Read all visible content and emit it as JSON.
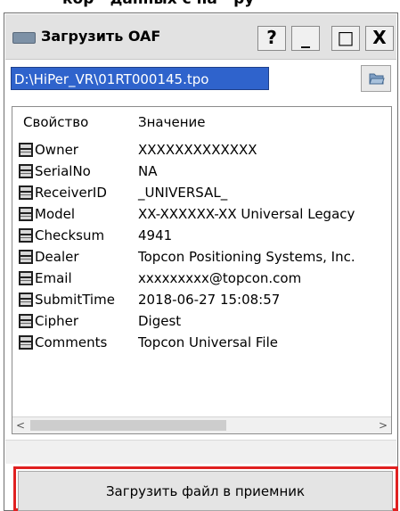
{
  "top_fragment": "кор · данных с на · ру",
  "window": {
    "title": "Загрузить OAF",
    "buttons": {
      "help": "?",
      "minimize": "_",
      "maximize": "□",
      "close": "X"
    }
  },
  "path": {
    "value": "D:\\HiPer_VR\\01RT000145.tpo"
  },
  "columns": {
    "property": "Свойство",
    "value": "Значение"
  },
  "rows": [
    {
      "name": "Owner",
      "value": "XXXXXXXXXXXXX"
    },
    {
      "name": "SerialNo",
      "value": "NA"
    },
    {
      "name": "ReceiverID",
      "value": "_UNIVERSAL_"
    },
    {
      "name": "Model",
      "value": "XX-XXXXXX-XX Universal Legacy"
    },
    {
      "name": "Checksum",
      "value": "4941"
    },
    {
      "name": "Dealer",
      "value": "Topcon Positioning Systems, Inc."
    },
    {
      "name": "Email",
      "value": "xxxxxxxxx@topcon.com"
    },
    {
      "name": "SubmitTime",
      "value": "2018-06-27 15:08:57"
    },
    {
      "name": "Cipher",
      "value": "Digest"
    },
    {
      "name": "Comments",
      "value": "Topcon Universal File"
    }
  ],
  "scroll": {
    "left": "<",
    "right": ">"
  },
  "upload_button": "Загрузить файл в приемник",
  "icons": {
    "app": "window-app-icon",
    "folder": "folder-open-icon",
    "row": "property-row-icon"
  }
}
